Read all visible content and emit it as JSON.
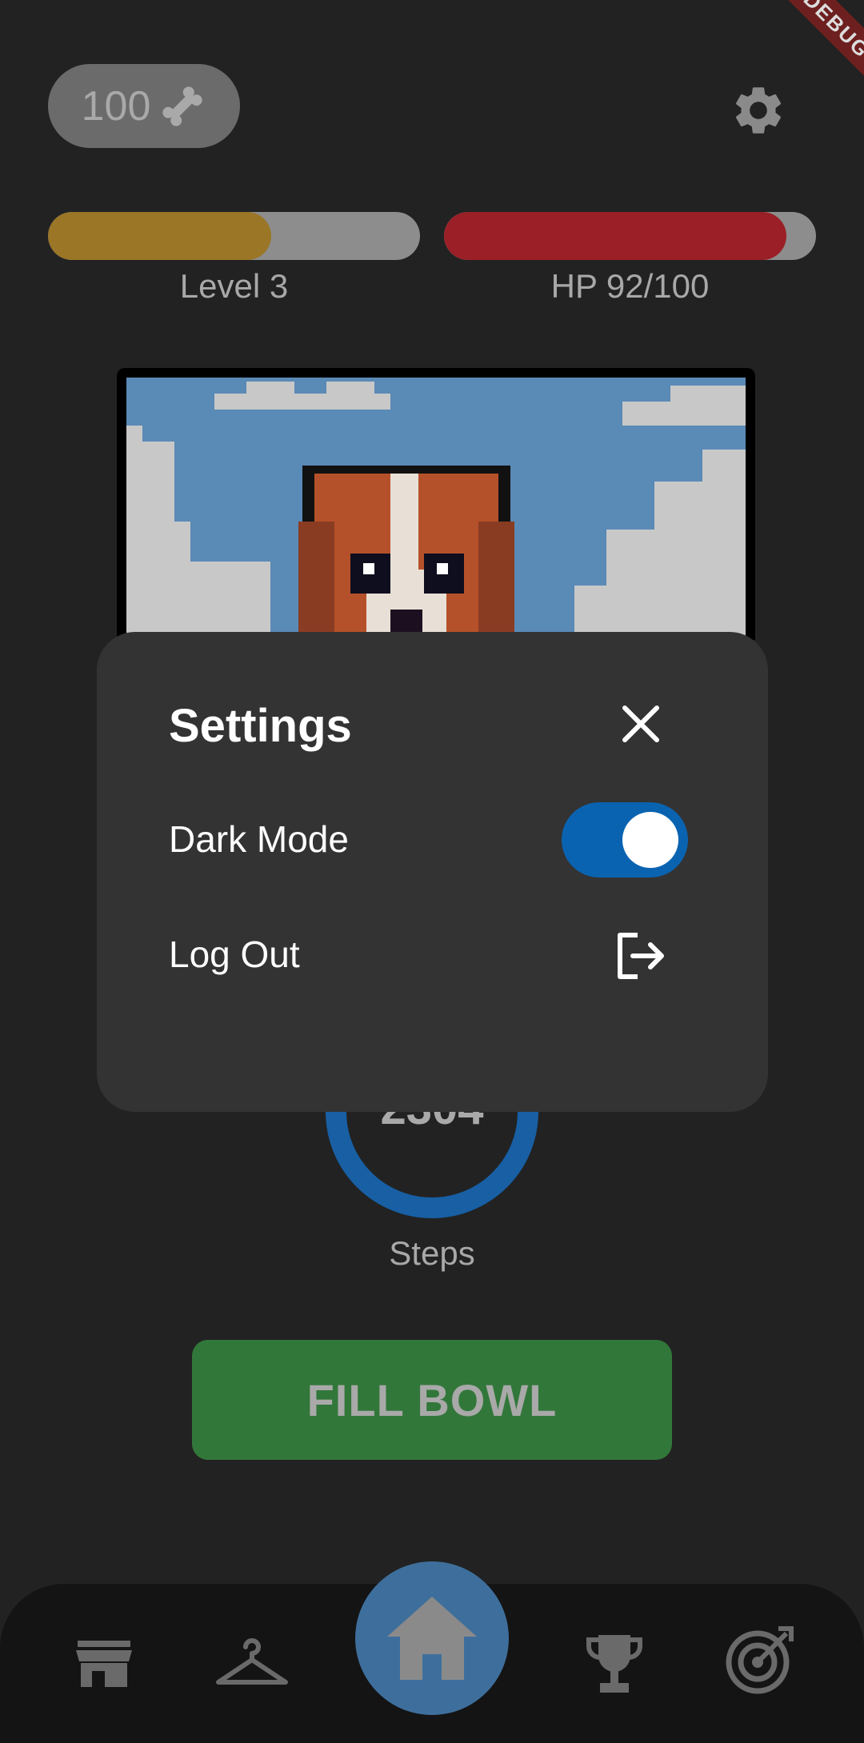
{
  "header": {
    "bone_count": "100",
    "bone_icon": "bone-icon",
    "settings_icon": "gear-icon",
    "debug_banner": "DEBUG"
  },
  "stats": {
    "level_label": "Level 3",
    "level_progress": 0.6,
    "level_color": "#9a7626",
    "hp_label": "HP 92/100",
    "hp_progress": 0.92,
    "hp_color": "#9a1f27"
  },
  "steps": {
    "count": "2304",
    "label": "Steps"
  },
  "actions": {
    "fill_bowl": "FILL BOWL"
  },
  "nav": {
    "items": [
      "shop-icon",
      "hanger-icon",
      "home-icon",
      "trophy-icon",
      "target-icon"
    ]
  },
  "settings_modal": {
    "title": "Settings",
    "dark_mode_label": "Dark Mode",
    "dark_mode_on": true,
    "logout_label": "Log Out",
    "accent": "#0a63b0"
  }
}
